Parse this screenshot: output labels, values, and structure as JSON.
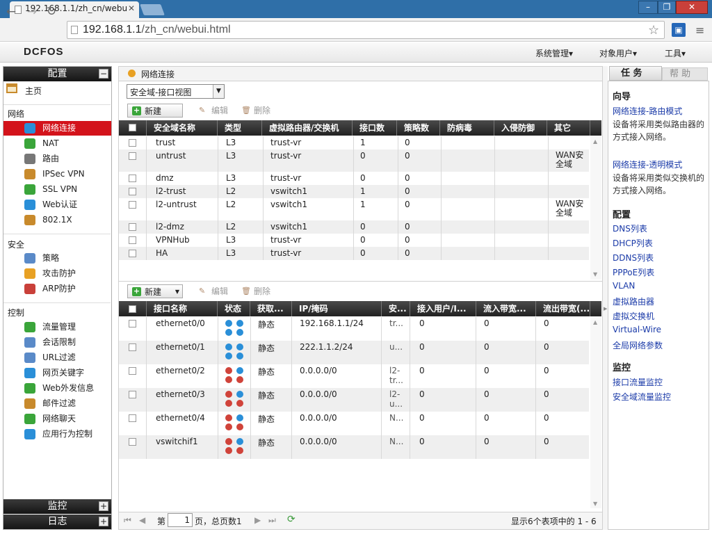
{
  "browser": {
    "tab_title": "192.168.1.1/zh_cn/webu",
    "url_host": "192.168.1.1",
    "url_path": "/zh_cn/webui.html"
  },
  "app": {
    "logo": "DCFOS",
    "top_menu": [
      "系统管理▾",
      "对象用户▾",
      "工具▾"
    ]
  },
  "left_panel": {
    "config_title": "配置",
    "home": "主页",
    "sections": {
      "network": "网络",
      "security": "安全",
      "control": "控制"
    },
    "network_items": [
      "网络连接",
      "NAT",
      "路由",
      "IPSec VPN",
      "SSL VPN",
      "Web认证",
      "802.1X"
    ],
    "security_items": [
      "策略",
      "攻击防护",
      "ARP防护"
    ],
    "control_items": [
      "流量管理",
      "会话限制",
      "URL过滤",
      "网页关键字",
      "Web外发信息",
      "邮件过滤",
      "网络聊天",
      "应用行为控制"
    ],
    "monitor_title": "监控",
    "log_title": "日志",
    "collapse_symbol": "−",
    "expand_symbol": "+"
  },
  "breadcrumb": "网络连接",
  "view_select": "安全域-接口视图",
  "toolbar": {
    "new": "新建",
    "edit": "编辑",
    "delete": "删除"
  },
  "zone_table": {
    "headers": [
      "安全域名称",
      "类型",
      "虚拟路由器/交换机",
      "接口数",
      "策略数",
      "防病毒",
      "入侵防御",
      "其它"
    ],
    "rows": [
      {
        "name": "trust",
        "type": "L3",
        "vr": "trust-vr",
        "ifs": "1",
        "policies": "0",
        "av": "",
        "ips": "",
        "other": ""
      },
      {
        "name": "untrust",
        "type": "L3",
        "vr": "trust-vr",
        "ifs": "0",
        "policies": "0",
        "av": "",
        "ips": "",
        "other": "WAN安全域"
      },
      {
        "name": "dmz",
        "type": "L3",
        "vr": "trust-vr",
        "ifs": "0",
        "policies": "0",
        "av": "",
        "ips": "",
        "other": ""
      },
      {
        "name": "l2-trust",
        "type": "L2",
        "vr": "vswitch1",
        "ifs": "1",
        "policies": "0",
        "av": "",
        "ips": "",
        "other": ""
      },
      {
        "name": "l2-untrust",
        "type": "L2",
        "vr": "vswitch1",
        "ifs": "1",
        "policies": "0",
        "av": "",
        "ips": "",
        "other": "WAN安全域"
      },
      {
        "name": "l2-dmz",
        "type": "L2",
        "vr": "vswitch1",
        "ifs": "0",
        "policies": "0",
        "av": "",
        "ips": "",
        "other": ""
      },
      {
        "name": "VPNHub",
        "type": "L3",
        "vr": "trust-vr",
        "ifs": "0",
        "policies": "0",
        "av": "",
        "ips": "",
        "other": ""
      },
      {
        "name": "HA",
        "type": "L3",
        "vr": "trust-vr",
        "ifs": "0",
        "policies": "0",
        "av": "",
        "ips": "",
        "other": ""
      }
    ]
  },
  "iface_table": {
    "headers": [
      "接口名称",
      "状态",
      "获取...",
      "IP/掩码",
      "安...",
      "接入用户/I...",
      "流入带宽...",
      "流出带宽(..."
    ],
    "rows": [
      {
        "name": "ethernet0/0",
        "status": [
          "up",
          "up",
          "up",
          "up"
        ],
        "acquire": "静态",
        "ip": "192.168.1.1/24",
        "zone": [
          "tr..."
        ],
        "users": "0",
        "in": "0",
        "out": "0"
      },
      {
        "name": "ethernet0/1",
        "status": [
          "up",
          "up",
          "up",
          "up"
        ],
        "acquire": "静态",
        "ip": "222.1.1.2/24",
        "zone": [
          "u..."
        ],
        "users": "0",
        "in": "0",
        "out": "0"
      },
      {
        "name": "ethernet0/2",
        "status": [
          "down",
          "up",
          "down",
          "down"
        ],
        "acquire": "静态",
        "ip": "0.0.0.0/0",
        "zone": [
          "l2-",
          "tr..."
        ],
        "users": "0",
        "in": "0",
        "out": "0"
      },
      {
        "name": "ethernet0/3",
        "status": [
          "down",
          "up",
          "down",
          "down"
        ],
        "acquire": "静态",
        "ip": "0.0.0.0/0",
        "zone": [
          "l2-",
          "u..."
        ],
        "users": "0",
        "in": "0",
        "out": "0"
      },
      {
        "name": "ethernet0/4",
        "status": [
          "down",
          "up",
          "down",
          "down"
        ],
        "acquire": "静态",
        "ip": "0.0.0.0/0",
        "zone": [
          "N..."
        ],
        "users": "0",
        "in": "0",
        "out": "0"
      },
      {
        "name": "vswitchif1",
        "status": [
          "down",
          "up",
          "down",
          "down"
        ],
        "acquire": "静态",
        "ip": "0.0.0.0/0",
        "zone": [
          "N..."
        ],
        "users": "0",
        "in": "0",
        "out": "0"
      }
    ]
  },
  "pager": {
    "page_prefix": "第",
    "page_value": "1",
    "page_suffix": "页，总页数1",
    "summary": "显示6个表项中的 1 - 6"
  },
  "right_panel": {
    "tab_tasks": "任 务",
    "tab_help": "帮 助",
    "wizard_title": "向导",
    "wizard_items": [
      {
        "link": "网络连接-路由模式",
        "desc": "设备将采用类似路由器的方式接入网络。"
      },
      {
        "link": "网络连接-透明模式",
        "desc": "设备将采用类似交换机的方式接入网络。"
      }
    ],
    "config_title": "配置",
    "config_links": [
      "DNS列表",
      "DHCP列表",
      "DDNS列表",
      "PPPoE列表",
      "VLAN",
      "虚拟路由器",
      "虚拟交换机",
      "Virtual-Wire",
      "全局网络参数"
    ],
    "monitor_title": "监控",
    "monitor_links": [
      "接口流量监控",
      "安全域流量监控"
    ]
  },
  "colors": {
    "active_item": "#d3131b",
    "link": "#1a3aa8",
    "header_dark": "#222222",
    "status_up": "#2a8fd8",
    "status_down": "#d0433a"
  }
}
